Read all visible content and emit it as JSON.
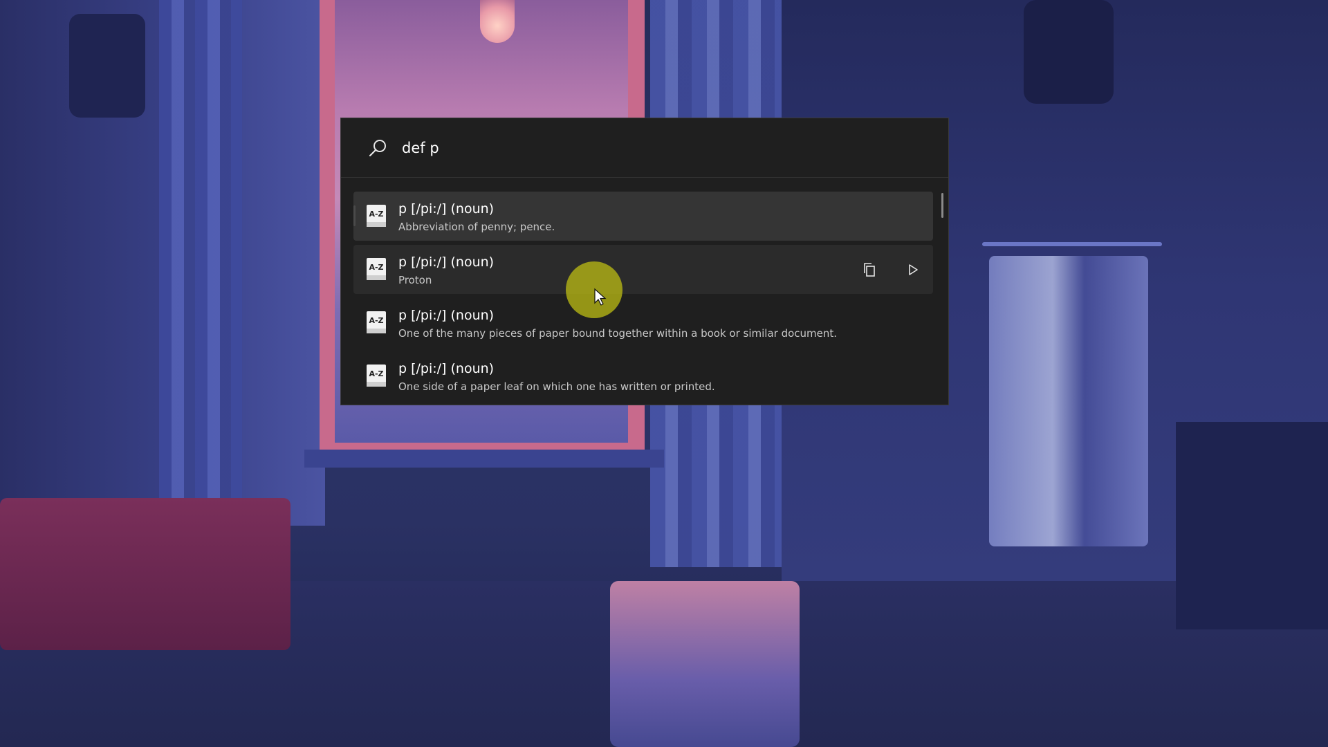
{
  "search": {
    "value": "def p",
    "icon": "search-icon"
  },
  "results": [
    {
      "title": "p [/pi:/] (noun)",
      "subtitle": "Abbreviation of penny; pence.",
      "icon": "dictionary-icon",
      "state": "selected"
    },
    {
      "title": "p [/pi:/] (noun)",
      "subtitle": "Proton",
      "icon": "dictionary-icon",
      "state": "hover"
    },
    {
      "title": "p [/pi:/] (noun)",
      "subtitle": "One of the many pieces of paper bound together within a book or similar document.",
      "icon": "dictionary-icon",
      "state": "normal"
    },
    {
      "title": "p [/pi:/] (noun)",
      "subtitle": "One side of a paper leaf on which one has written or printed.",
      "icon": "dictionary-icon",
      "state": "normal"
    }
  ],
  "actions": {
    "copy_icon": "copy-icon",
    "run_icon": "play-icon"
  },
  "colors": {
    "panel": "#1f1f1f",
    "selected_row": "#353535",
    "hover_row": "#2b2b2b",
    "cursor_halo": "#bebe14"
  }
}
